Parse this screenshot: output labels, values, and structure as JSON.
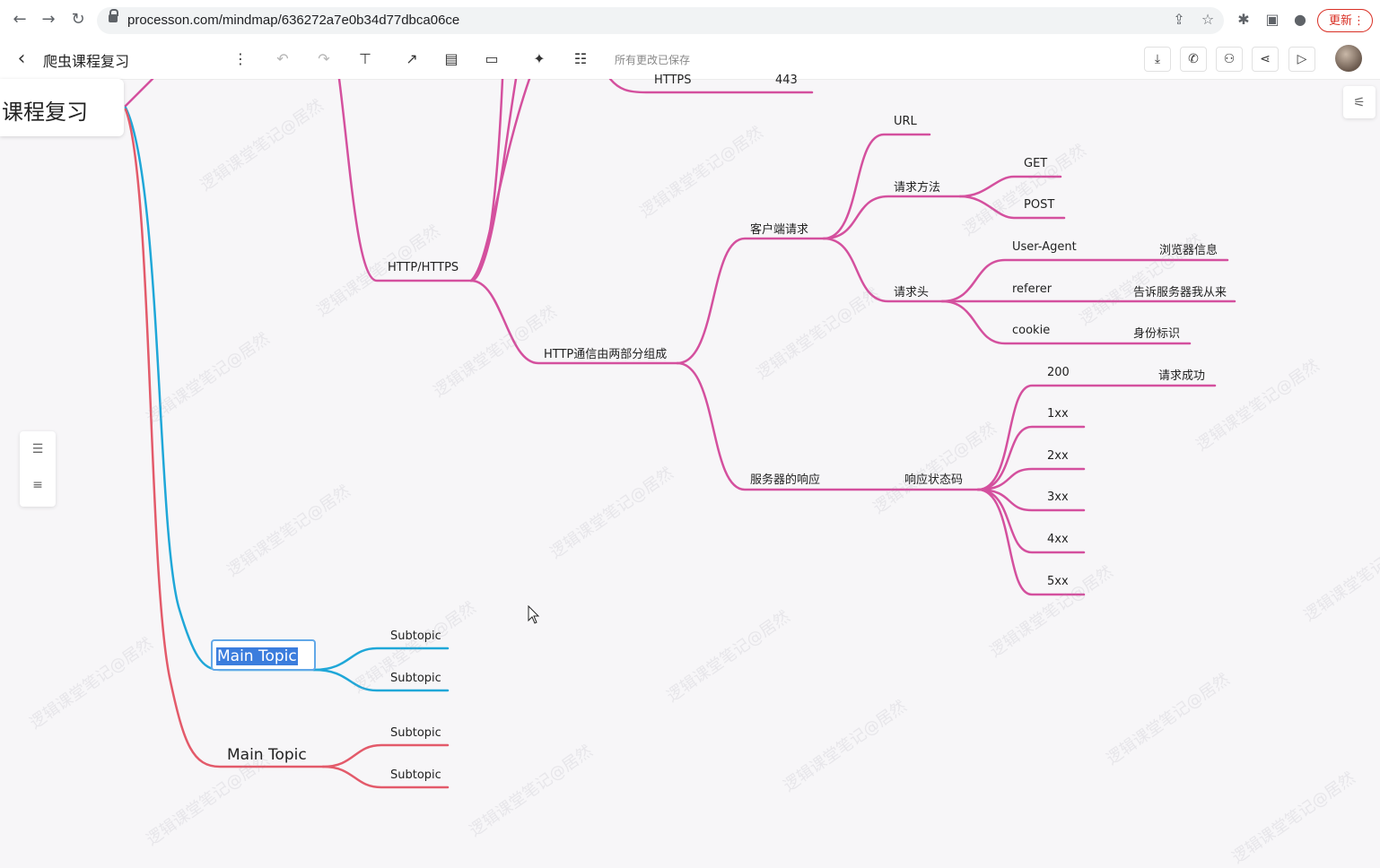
{
  "browser": {
    "url": "processon.com/mindmap/636272a7e0b34d77dbca06ce",
    "update_label": "更新",
    "icons": [
      "back-icon",
      "forward-icon",
      "reload-icon",
      "share-icon",
      "star-icon",
      "extensions-icon",
      "sidepanel-icon",
      "profile-icon",
      "menu-icon"
    ]
  },
  "toolbar": {
    "back_icon": "‹",
    "title": "爬虫课程复习",
    "save_status": "所有更改已保存",
    "icons": [
      "more-icon",
      "undo-icon",
      "redo-icon",
      "format-painter-icon",
      "line-style-icon",
      "layout-icon",
      "frame-icon",
      "magic-icon",
      "structure-icon",
      "download-icon",
      "phone-icon",
      "collaborate-icon",
      "share-icon",
      "present-icon"
    ]
  },
  "mindmap": {
    "root": "课程复习",
    "partial_top": {
      "https": "HTTPS",
      "port": "443"
    },
    "http_node": "HTTP/HTTPS",
    "http_comm": "HTTP通信由两部分组成",
    "client_request": "客户端请求",
    "url": "URL",
    "request_method": "请求方法",
    "get": "GET",
    "post": "POST",
    "request_header": "请求头",
    "user_agent": "User-Agent",
    "user_agent_desc": "浏览器信息",
    "referer": "referer",
    "referer_desc": "告诉服务器我从来",
    "cookie": "cookie",
    "cookie_desc": "身份标识",
    "server_response": "服务器的响应",
    "status_code": "响应状态码",
    "code_200": "200",
    "code_200_desc": "请求成功",
    "code_1xx": "1xx",
    "code_2xx": "2xx",
    "code_3xx": "3xx",
    "code_4xx": "4xx",
    "code_5xx": "5xx",
    "main_topic_selected": "Main Topic",
    "main_topic_2": "Main Topic",
    "subtopic_1": "Subtopic",
    "subtopic_2": "Subtopic",
    "subtopic_3": "Subtopic",
    "subtopic_4": "Subtopic"
  },
  "watermark": "逻辑课堂笔记@居然",
  "colors": {
    "pink_branch": "#d4509e",
    "blue_branch": "#1fa7d8",
    "red_branch": "#e35a6a",
    "selection": "#3b7ddd"
  }
}
